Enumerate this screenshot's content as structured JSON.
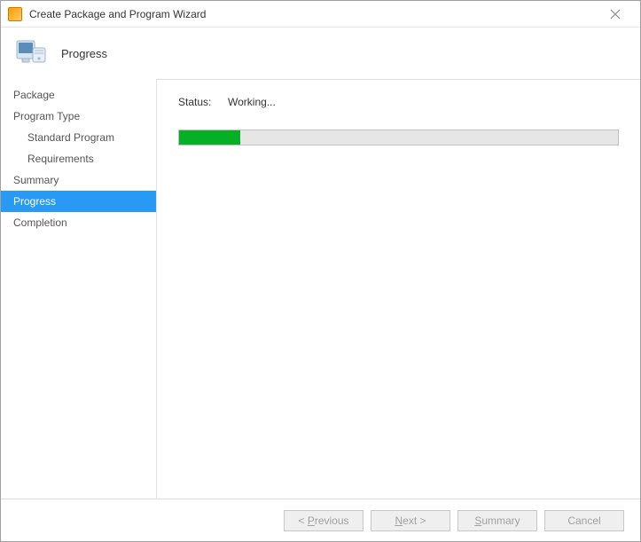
{
  "window": {
    "title": "Create Package and Program Wizard"
  },
  "header": {
    "title": "Progress"
  },
  "sidebar": {
    "items": [
      {
        "label": "Package",
        "sub": false,
        "selected": false
      },
      {
        "label": "Program Type",
        "sub": false,
        "selected": false
      },
      {
        "label": "Standard Program",
        "sub": true,
        "selected": false
      },
      {
        "label": "Requirements",
        "sub": true,
        "selected": false
      },
      {
        "label": "Summary",
        "sub": false,
        "selected": false
      },
      {
        "label": "Progress",
        "sub": false,
        "selected": true
      },
      {
        "label": "Completion",
        "sub": false,
        "selected": false
      }
    ]
  },
  "content": {
    "status_label": "Status:",
    "status_value": "Working...",
    "progress_percent": 14
  },
  "footer": {
    "previous": "Previous",
    "next": "Next",
    "summary": "Summary",
    "cancel": "Cancel"
  }
}
